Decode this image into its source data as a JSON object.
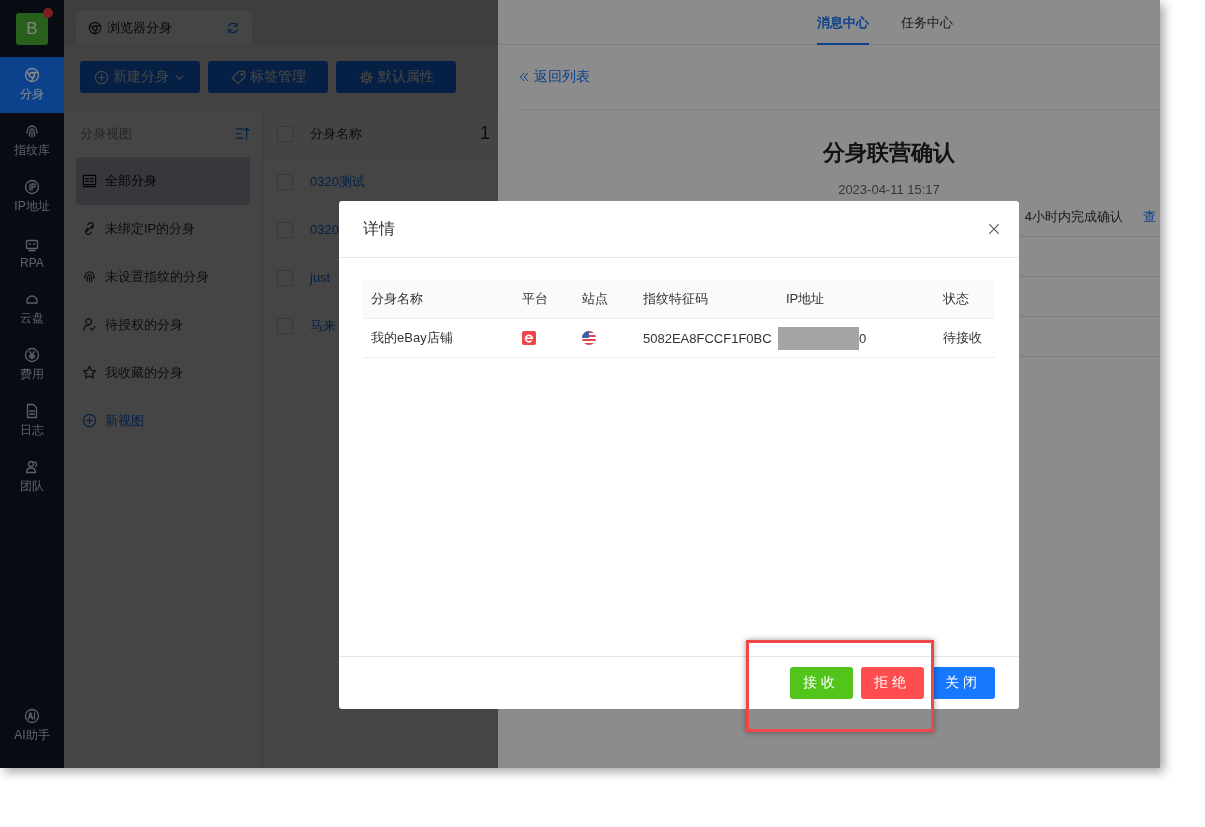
{
  "sidebar": {
    "logo": {
      "letter": "B",
      "notification": true
    },
    "items": [
      {
        "label": "分身",
        "kind": "browser",
        "selected": true
      },
      {
        "label": "指纹库",
        "kind": "fingerprint",
        "selected": false
      },
      {
        "label": "IP地址",
        "kind": "ip",
        "selected": false
      },
      {
        "label": "RPA",
        "kind": "robot",
        "selected": false
      },
      {
        "label": "云盘",
        "kind": "cloud",
        "selected": false
      },
      {
        "label": "费用",
        "kind": "fee",
        "selected": false
      },
      {
        "label": "日志",
        "kind": "log",
        "selected": false
      },
      {
        "label": "团队",
        "kind": "team",
        "selected": false
      }
    ],
    "bottom_item": {
      "label": "AI助手",
      "kind": "ai"
    }
  },
  "tabs": [
    {
      "label": "浏览器分身",
      "selected": true
    }
  ],
  "toolbar": {
    "buttons": [
      {
        "label": "新建分身",
        "kind": "add",
        "dropdown": true
      },
      {
        "label": "标签管理",
        "kind": "tag",
        "dropdown": false
      },
      {
        "label": "默认属性",
        "kind": "gear",
        "dropdown": false
      }
    ]
  },
  "views": {
    "title": "分身视图",
    "items": [
      {
        "label": "全部分身",
        "kind": "all",
        "selected": true
      },
      {
        "label": "未绑定IP的分身",
        "kind": "unlink",
        "selected": false
      },
      {
        "label": "未设置指纹的分身",
        "kind": "fingerprint",
        "selected": false
      },
      {
        "label": "待授权的分身",
        "kind": "user",
        "selected": false
      },
      {
        "label": "我收藏的分身",
        "kind": "star",
        "selected": false
      }
    ],
    "add_label": "新视图"
  },
  "table": {
    "all_checked": false,
    "columns": [
      "分身名称",
      "1"
    ],
    "rows": [
      {
        "name": "0320测试",
        "checked": false
      },
      {
        "name": "0320",
        "checked": false
      },
      {
        "name": "just",
        "checked": false
      },
      {
        "name": "马来",
        "checked": false
      }
    ]
  },
  "drawer": {
    "tabs": [
      {
        "label": "消息中心",
        "selected": true
      },
      {
        "label": "任务中心",
        "selected": false
      }
    ],
    "back_link": "返回列表",
    "title": "分身联营确认",
    "date": "2023-04-11 15:17",
    "notice": "4小时内完成确认",
    "notice_link": "查"
  },
  "modal": {
    "title": "详情",
    "columns": [
      "分身名称",
      "平台",
      "站点",
      "指纹特征码",
      "IP地址",
      "状态"
    ],
    "rows": [
      {
        "name": "我的eBay店铺",
        "platform": {
          "kind": "ebay"
        },
        "site": {
          "kind": "us"
        },
        "fingerprint": "5082EA8FCCF1F0BC",
        "ip": "0",
        "ip_redacted": true,
        "status": "待接收"
      }
    ],
    "buttons": [
      {
        "label": "接收",
        "kind": "accept"
      },
      {
        "label": "拒绝",
        "kind": "reject"
      },
      {
        "label": "关闭",
        "kind": "close"
      }
    ]
  },
  "annotation": {
    "kind": "highlight-frame"
  }
}
